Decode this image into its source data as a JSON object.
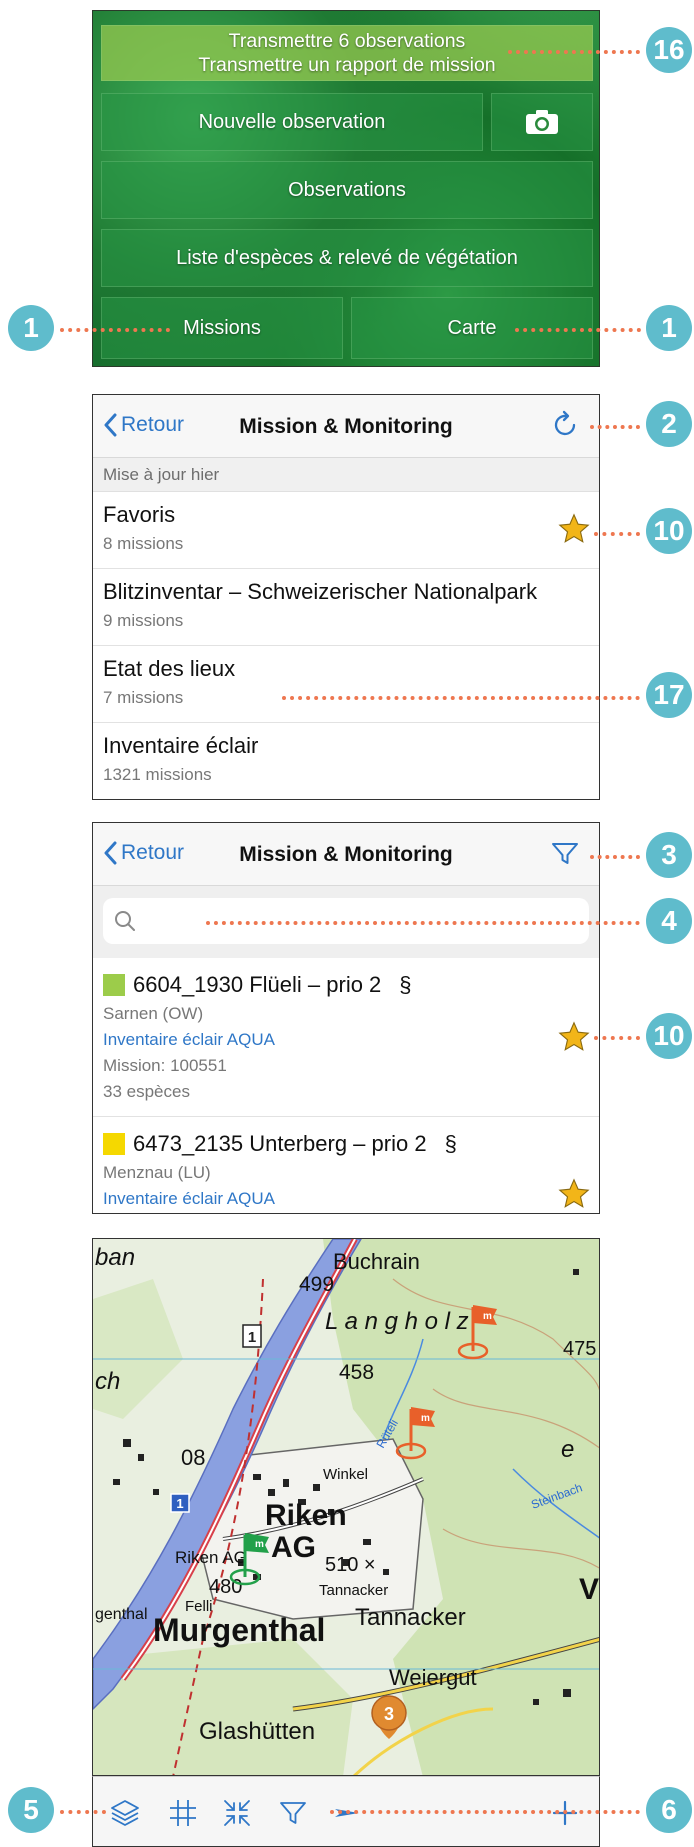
{
  "home": {
    "transmit_line1": "Transmettre 6 observations",
    "transmit_line2": "Transmettre un rapport de mission",
    "new_observation": "Nouvelle observation",
    "observations": "Observations",
    "species_list": "Liste d'espèces & relevé de végétation",
    "missions": "Missions",
    "map": "Carte"
  },
  "mission_list": {
    "back": "Retour",
    "title": "Mission & Monitoring",
    "updated": "Mise à jour hier",
    "items": [
      {
        "title": "Favoris",
        "subtitle": "8 missions",
        "favorite": true
      },
      {
        "title": "Blitzinventar – Schweizerischer Nationalpark",
        "subtitle": "9 missions"
      },
      {
        "title": "Etat des lieux",
        "subtitle": "7 missions"
      },
      {
        "title": "Inventaire éclair",
        "subtitle": "1321 missions"
      }
    ]
  },
  "mission_detail": {
    "back": "Retour",
    "title": "Mission & Monitoring",
    "search_placeholder": "",
    "items": [
      {
        "color": "#9ccc4a",
        "title": "6604_1930 Flüeli – prio 2",
        "paragraph": "§",
        "location": "Sarnen (OW)",
        "program": "Inventaire éclair AQUA",
        "mission": "Mission: 100551",
        "species": "33 espèces"
      },
      {
        "color": "#f5d800",
        "title": "6473_2135 Unterberg – prio 2",
        "paragraph": "§",
        "location": "Menznau (LU)",
        "program": "Inventaire éclair AQUA"
      }
    ]
  },
  "map": {
    "labels": {
      "buchrain": "Buchrain",
      "n499": "499",
      "lang": "L a n g h o l z",
      "n458": "458",
      "n475": "475",
      "winkel": "Winkel",
      "riken": "Riken",
      "ag": "AG",
      "riken_ag": "Riken AG",
      "n480": "480",
      "felli": "Felli",
      "n510": "510 ×",
      "tannacker_small": "Tannacker",
      "tannacker": "Tannacker",
      "murgenthal": "Murgenthal",
      "genthal": "genthal",
      "weiergut": "Weiergut",
      "glashutten": "Glashütten",
      "ban": "ban",
      "ch": "ch",
      "n08": "08",
      "road1": "1",
      "road1b": "1",
      "cluster": "3",
      "V": "V",
      "e_big": "e",
      "r_label": "Rüteli",
      "steinbach": "Steinbach"
    }
  },
  "callouts": [
    "16",
    "1",
    "1",
    "2",
    "10",
    "17",
    "3",
    "4",
    "10",
    "5",
    "6"
  ],
  "colors": {
    "accent": "#2f77c7",
    "badge": "#5fbccc",
    "dots": "#ee7750",
    "star": "#f2b518"
  }
}
